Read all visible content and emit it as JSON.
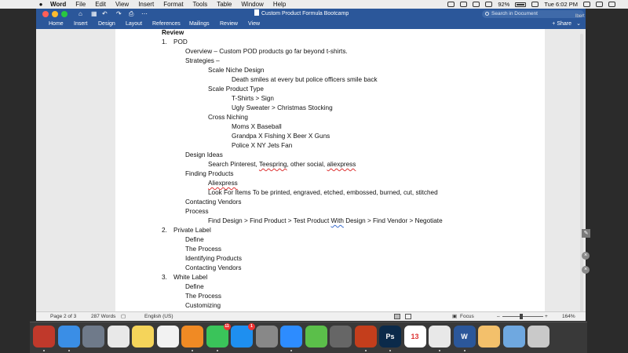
{
  "menubar": {
    "apple_icon": "apple-icon",
    "app": "Word",
    "items": [
      "File",
      "Edit",
      "View",
      "Insert",
      "Format",
      "Tools",
      "Table",
      "Window",
      "Help"
    ],
    "battery": "92%",
    "clock": "Tue 6:02 PM"
  },
  "titlebar": {
    "title": "Custom Product Formula Bootcamp",
    "search_placeholder": "Search in Document",
    "user_fragment": "lbert"
  },
  "ribbon": {
    "tabs": [
      "Home",
      "Insert",
      "Design",
      "Layout",
      "References",
      "Mailings",
      "Review",
      "View"
    ],
    "share": "Share"
  },
  "document": {
    "lines": [
      {
        "text": "Review",
        "bold": true
      },
      {
        "num": "1.",
        "text": "POD"
      },
      {
        "text": "Overview – Custom POD products go far beyond t-shirts."
      },
      {
        "text": "Strategies –"
      },
      {
        "text": "Scale Niche Design"
      },
      {
        "text": "Death smiles at every but police officers smile back"
      },
      {
        "text": "Scale Product Type"
      },
      {
        "text": "T-Shirts > Sign"
      },
      {
        "text": "Ugly Sweater > Christmas Stocking"
      },
      {
        "text": "Cross Niching"
      },
      {
        "text": "Moms X Baseball"
      },
      {
        "text": "Grandpa X Fishing X Beer X Guns"
      },
      {
        "text": "Police X NY Jets Fan"
      },
      {
        "text": "Design Ideas"
      },
      {
        "text": "Search Pinterest, Teespring, other social, aliexpress"
      },
      {
        "text": "Finding Products"
      },
      {
        "text": "Aliexpress"
      },
      {
        "text": "Look For Items To be printed, engraved, etched, embossed, burned, cut, stitched"
      },
      {
        "text": "Contacting Vendors"
      },
      {
        "text": "Process"
      },
      {
        "text": "Find Design > Find Product > Test Product With Design > Find Vendor > Negotiate"
      },
      {
        "num": "2.",
        "text": "Private Label"
      },
      {
        "text": "Define"
      },
      {
        "text": "The Process"
      },
      {
        "text": "Identifying Products"
      },
      {
        "text": "Contacting Vendors"
      },
      {
        "num": "3.",
        "text": "White Label"
      },
      {
        "text": "Define"
      },
      {
        "text": "The Process"
      },
      {
        "text": "Customizing"
      }
    ],
    "spelling_errors": [
      "Teespring",
      "aliexpress",
      "Aliexpress"
    ],
    "grammar_flags": [
      "With"
    ]
  },
  "statusbar": {
    "page": "Page 2 of 3",
    "words": "287 Words",
    "language": "English (US)",
    "focus": "Focus",
    "zoom_minus": "–",
    "zoom_plus": "+",
    "zoom": "164%"
  },
  "dock": {
    "apps": [
      {
        "icon": "slides-icon",
        "color": "#c0392b"
      },
      {
        "icon": "finder-icon",
        "color": "#3a8ee6"
      },
      {
        "icon": "launchpad-icon",
        "color": "#6f7a8a"
      },
      {
        "icon": "textedit-icon",
        "color": "#e8e8e8"
      },
      {
        "icon": "notes-icon",
        "color": "#f5d45a"
      },
      {
        "icon": "reminders-icon",
        "color": "#f2f2f2"
      },
      {
        "icon": "books-icon",
        "color": "#f08a24"
      },
      {
        "icon": "facetime-icon",
        "color": "#3ac45a",
        "badge": "11"
      },
      {
        "icon": "appstore-icon",
        "color": "#1e8ff0",
        "badge": "1"
      },
      {
        "icon": "system-preferences-icon",
        "color": "#888888"
      },
      {
        "icon": "zoom-icon",
        "color": "#2d8cff"
      },
      {
        "icon": "camtasia-icon",
        "color": "#5bbf4a"
      },
      {
        "icon": "calculator-icon",
        "color": "#666666"
      },
      {
        "icon": "powerpoint-icon",
        "color": "#c43e1c"
      },
      {
        "icon": "photoshop-icon",
        "color": "#0b2a4a",
        "label": "Ps"
      },
      {
        "icon": "calendar-icon",
        "color": "#ffffff",
        "label": "13"
      },
      {
        "icon": "chrome-icon",
        "color": "#e8e8e8"
      },
      {
        "icon": "word-icon",
        "color": "#2b579a",
        "label": "W"
      },
      {
        "icon": "photos-icon",
        "color": "#f3c06b"
      },
      {
        "icon": "downloads-icon",
        "color": "#6fa8e0"
      },
      {
        "icon": "trash-icon",
        "color": "#c9c9c9"
      }
    ]
  }
}
